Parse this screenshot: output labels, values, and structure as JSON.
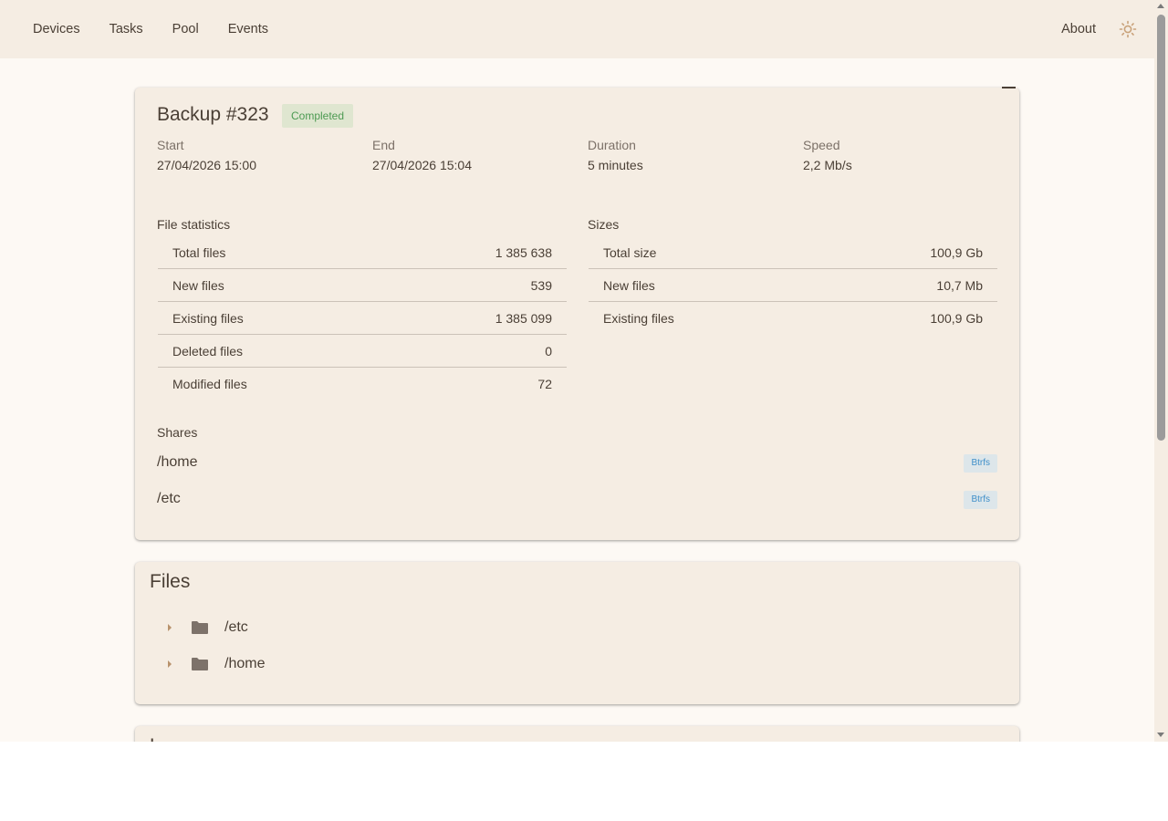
{
  "nav": {
    "items": [
      "Devices",
      "Tasks",
      "Pool",
      "Events"
    ],
    "about": "About",
    "theme_icon": "sun-icon"
  },
  "backup": {
    "title": "Backup #323",
    "status": "Completed",
    "status_color": "#4c9a52",
    "start_label": "Start",
    "start_value": "27/04/2026 15:00",
    "end_label": "End",
    "end_value": "27/04/2026 15:04",
    "duration_label": "Duration",
    "duration_value": "5 minutes",
    "speed_label": "Speed",
    "speed_value": "2,2 Mb/s"
  },
  "file_statistics": {
    "title": "File statistics",
    "rows": [
      {
        "label": "Total files",
        "value": "1 385 638"
      },
      {
        "label": "New files",
        "value": "539"
      },
      {
        "label": "Existing files",
        "value": "1 385 099"
      },
      {
        "label": "Deleted files",
        "value": "0"
      },
      {
        "label": "Modified files",
        "value": "72"
      }
    ]
  },
  "sizes": {
    "title": "Sizes",
    "rows": [
      {
        "label": "Total size",
        "value": "100,9 Gb"
      },
      {
        "label": "New files",
        "value": "10,7 Mb"
      },
      {
        "label": "Existing files",
        "value": "100,9 Gb"
      }
    ]
  },
  "shares": {
    "title": "Shares",
    "items": [
      {
        "path": "/home",
        "fs": "Btrfs"
      },
      {
        "path": "/etc",
        "fs": "Btrfs"
      }
    ]
  },
  "files": {
    "title": "Files",
    "items": [
      {
        "name": "/etc"
      },
      {
        "name": "/home"
      }
    ]
  },
  "next_card": {
    "title": "L"
  },
  "colors": {
    "accent": "#c9a27a",
    "badge_fs": "#3f8fc9"
  }
}
